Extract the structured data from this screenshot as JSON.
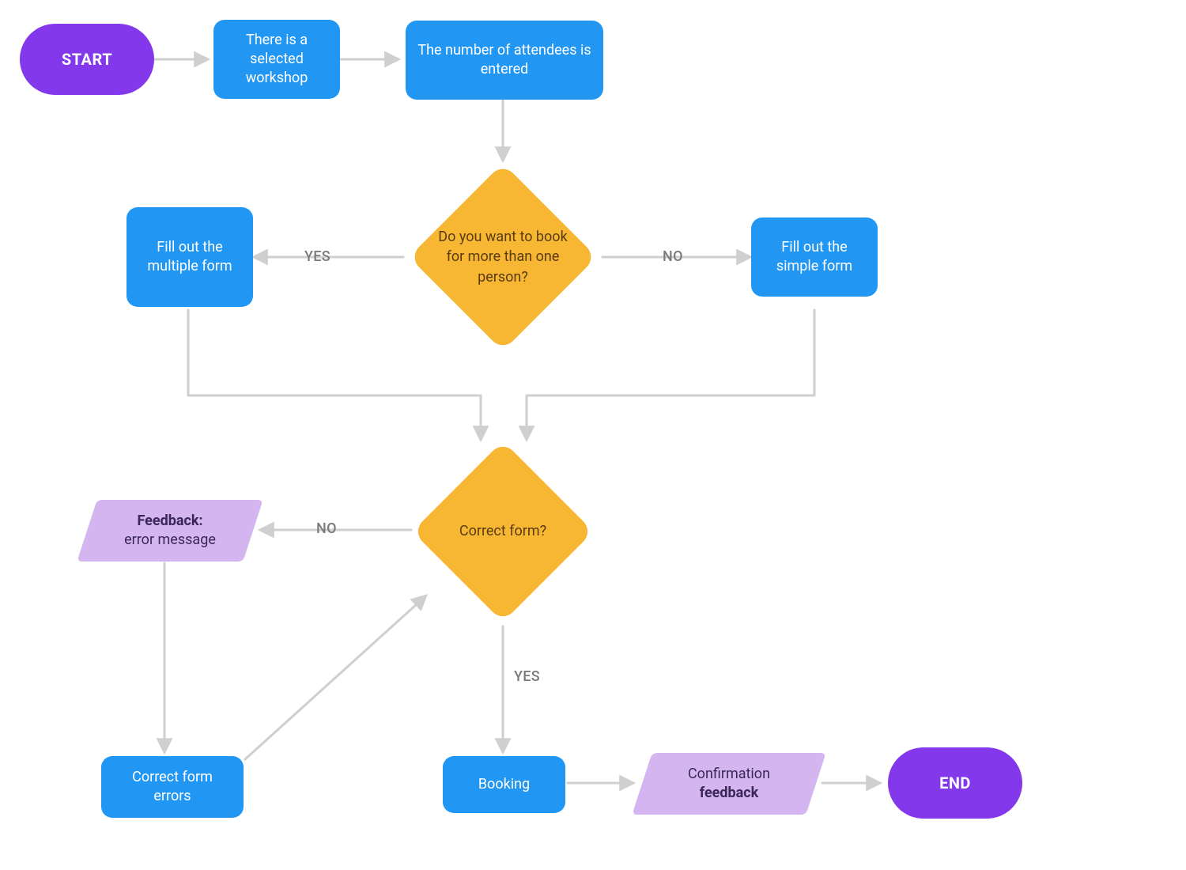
{
  "colors": {
    "terminator": "#8338ec",
    "process": "#2196f3",
    "decision": "#f7b733",
    "decision_text": "#5a3b12",
    "io": "#d4b5f0",
    "io_text": "#3a2756",
    "arrow": "#cfcfcf",
    "edge_label": "#7a7a7a"
  },
  "nodes": {
    "start": {
      "label": "START"
    },
    "selected_workshop": {
      "label": "There is a selected workshop"
    },
    "attendees_entered": {
      "label": "The number of attendees is entered"
    },
    "decision_multiple": {
      "label": "Do you want to book for more than one person?"
    },
    "fill_multiple": {
      "label": "Fill out the multiple form"
    },
    "fill_simple": {
      "label": "Fill out the simple form"
    },
    "decision_correct": {
      "label": "Correct form?"
    },
    "feedback_error_bold": "Feedback:",
    "feedback_error_rest": "error message",
    "correct_errors": {
      "label": "Correct form errors"
    },
    "booking": {
      "label": "Booking"
    },
    "confirmation_prefix": "Confirmation",
    "confirmation_bold": "feedback",
    "end": {
      "label": "END"
    }
  },
  "edge_labels": {
    "dec1_yes": "YES",
    "dec1_no": "NO",
    "dec2_no": "NO",
    "dec2_yes": "YES"
  }
}
